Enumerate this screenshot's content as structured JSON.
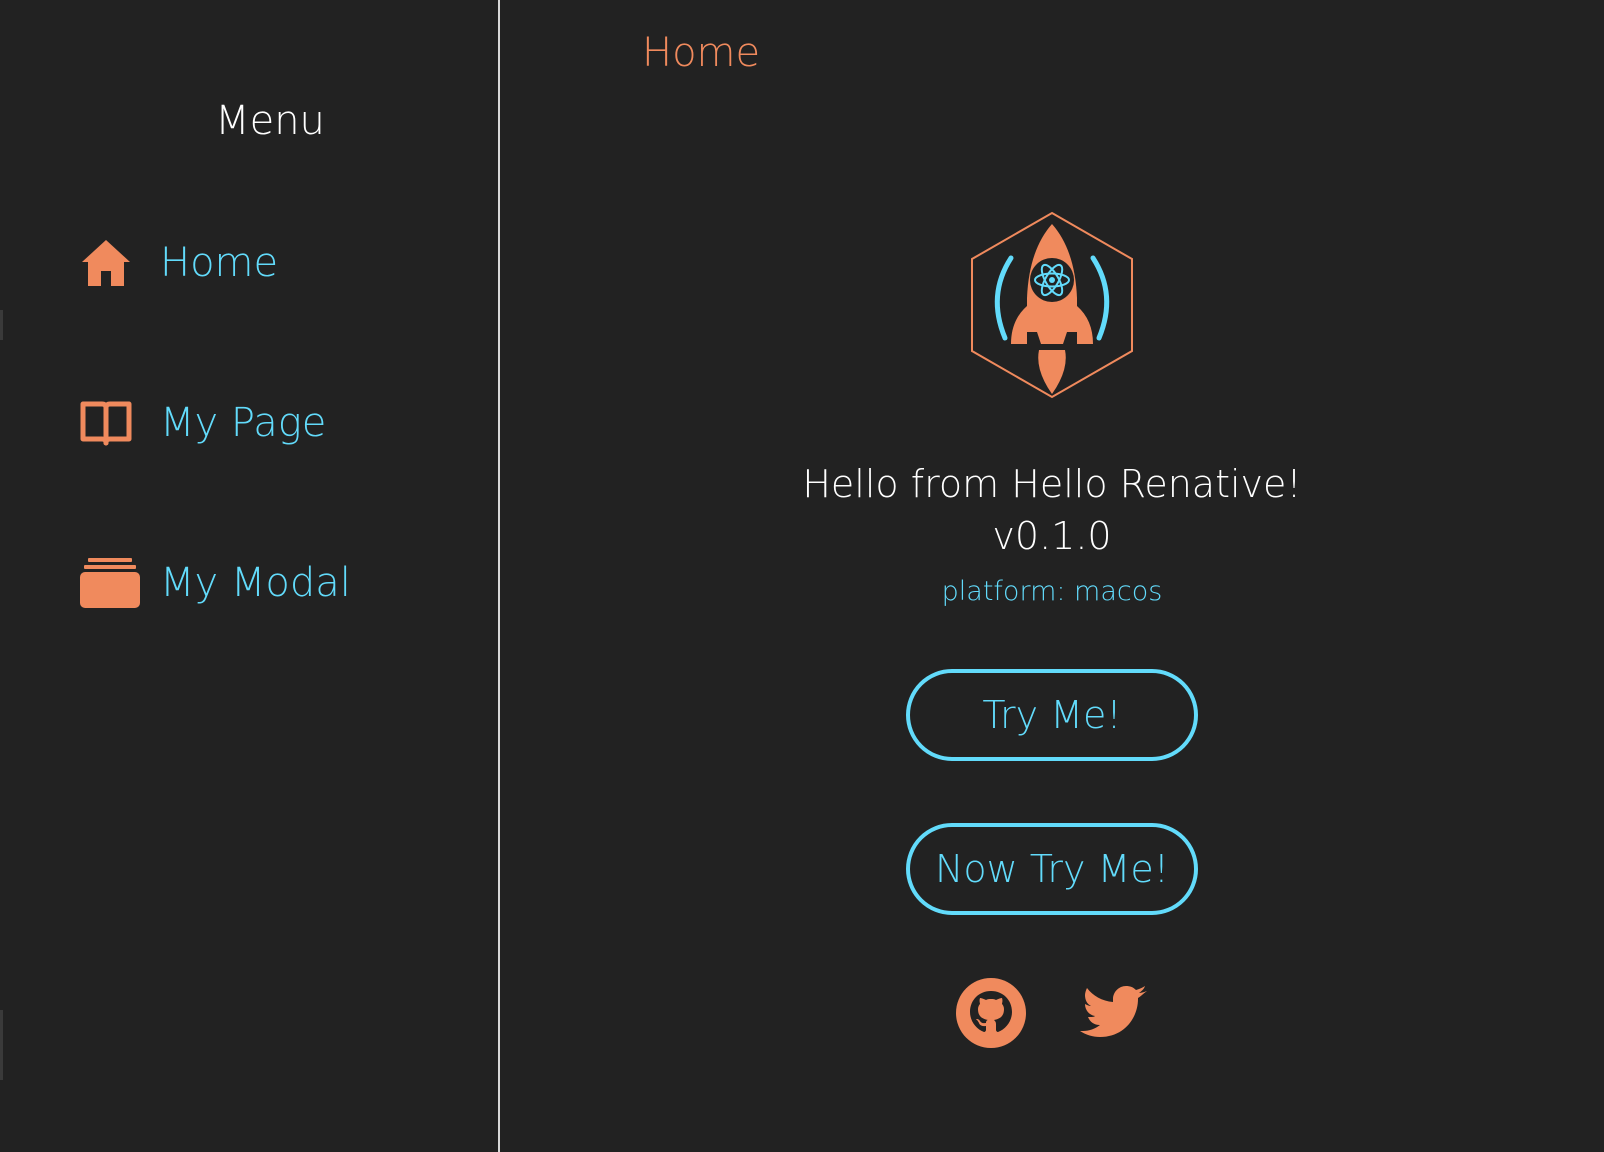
{
  "colors": {
    "background": "#222222",
    "accent_orange": "#f08a5d",
    "accent_blue": "#62dbfb",
    "text_white": "#ffffff",
    "divider": "#d8d8d8"
  },
  "sidebar": {
    "title": "Menu",
    "items": [
      {
        "label": "Home",
        "icon": "home-icon"
      },
      {
        "label": "My Page",
        "icon": "book-icon"
      },
      {
        "label": "My Modal",
        "icon": "stack-icon"
      }
    ]
  },
  "main": {
    "title": "Home",
    "logo": "rocket-logo",
    "hello": "Hello from Hello Renative!",
    "version": "v0.1.0",
    "platform": "platform: macos",
    "buttons": {
      "try_me": "Try Me!",
      "now_try_me": "Now Try Me!"
    },
    "social": [
      {
        "icon": "github-icon"
      },
      {
        "icon": "twitter-icon"
      }
    ]
  }
}
